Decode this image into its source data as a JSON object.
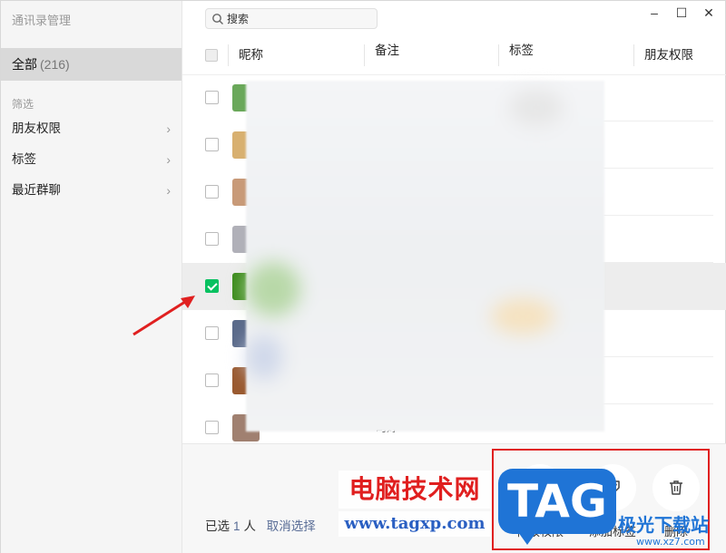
{
  "sidebar": {
    "title": "通讯录管理",
    "all_label": "全部",
    "all_count": "(216)",
    "filter_heading": "筛选",
    "items": [
      {
        "label": "朋友权限"
      },
      {
        "label": "标签"
      },
      {
        "label": "最近群聊"
      }
    ]
  },
  "search": {
    "placeholder": "搜索"
  },
  "window_controls": {
    "minimize": "–",
    "maximize": "☐",
    "close": "✕"
  },
  "columns": {
    "nickname": "昵称",
    "remark": "备注",
    "tag": "标签",
    "permission": "朋友权限"
  },
  "rows": [
    {
      "checked": false,
      "avatar_color": "#6aa85a",
      "nickname": "",
      "remark": ""
    },
    {
      "checked": false,
      "avatar_color": "#d8b070",
      "nickname": "",
      "remark": ""
    },
    {
      "checked": false,
      "avatar_color": "#c89a78",
      "nickname": "",
      "remark": ""
    },
    {
      "checked": false,
      "avatar_color": "#b0b0b8",
      "nickname": "",
      "remark": ""
    },
    {
      "checked": true,
      "avatar_color": "#3d8c1d",
      "nickname": "",
      "remark": ""
    },
    {
      "checked": false,
      "avatar_color": "#5a6a8a",
      "nickname": "",
      "remark": ""
    },
    {
      "checked": false,
      "avatar_color": "#9a5a30",
      "nickname": "",
      "remark": ""
    },
    {
      "checked": false,
      "avatar_color": "#a08070",
      "nickname": "",
      "remark": "司婷"
    }
  ],
  "footer": {
    "selected_prefix": "已选",
    "selected_count": "1",
    "selected_suffix": "人",
    "cancel_label": "取消选择",
    "actions": [
      {
        "label": "修改权限",
        "icon": "lock-icon"
      },
      {
        "label": "添加标签",
        "icon": "tag-icon"
      },
      {
        "label": "删除",
        "icon": "trash-icon"
      }
    ]
  },
  "watermark": {
    "cn": "电脑技术网",
    "url": "www.tagxp.com",
    "tag": "TAG",
    "site": "极光下载站",
    "site_url": "www.xz7.com"
  },
  "colors": {
    "accent_green": "#07c160",
    "link_blue": "#576b95",
    "annotation_red": "#e02020"
  }
}
